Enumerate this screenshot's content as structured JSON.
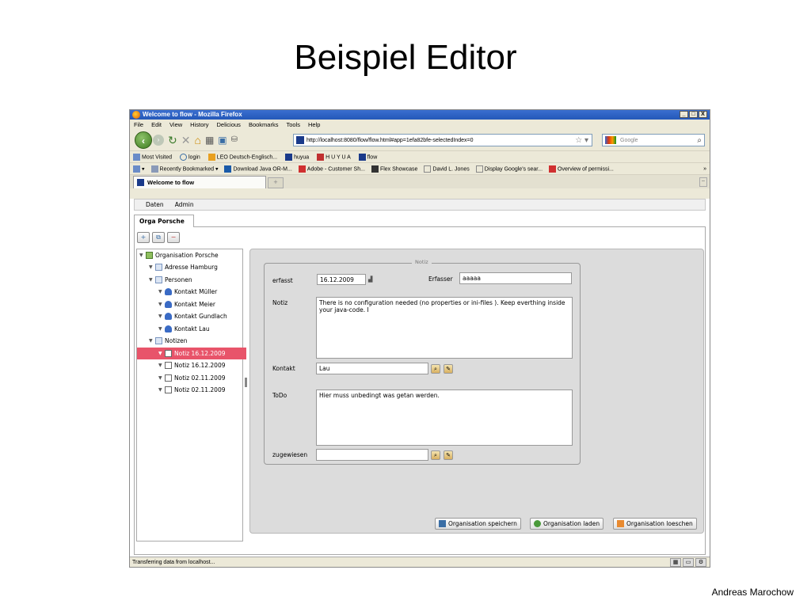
{
  "slide": {
    "title": "Beispiel Editor",
    "footer": "Andreas Marochow"
  },
  "browser": {
    "window_title": "Welcome to flow - Mozilla Firefox",
    "window_buttons": [
      "_",
      "□",
      "X"
    ],
    "menu": [
      "File",
      "Edit",
      "View",
      "History",
      "Delicious",
      "Bookmarks",
      "Tools",
      "Help"
    ],
    "url": "http://localhost:8080/flow/flow.html#app=1efa82bfe-selectedIndex=0",
    "search_placeholder": "Google",
    "bookmarks_row1": [
      "Most Visited",
      "login",
      "LEO Deutsch-Englisch...",
      "huyua",
      "H U Y U A",
      "flow"
    ],
    "bookmarks_row2": [
      "Recently Bookmarked",
      "Download Java OR-M...",
      "Adobe - Customer Sh...",
      "Flex Showcase",
      "David L. Jones",
      "Display Google's sear...",
      "Overview of permissi..."
    ],
    "overflow": "»",
    "tab_title": "Welcome to flow",
    "new_tab": "+",
    "status_text": "Transferring data from localhost..."
  },
  "app": {
    "menu": [
      "Daten",
      "Admin"
    ],
    "tab": "Orga Porsche",
    "tree": [
      {
        "label": "Organisation Porsche",
        "icon": "org-icon",
        "level": 0,
        "selected": false
      },
      {
        "label": "Adresse Hamburg",
        "icon": "folder-icon",
        "level": 1,
        "selected": false
      },
      {
        "label": "Personen",
        "icon": "folder-icon",
        "level": 1,
        "selected": false
      },
      {
        "label": "Kontakt Müller",
        "icon": "user-icon",
        "level": 2,
        "selected": false
      },
      {
        "label": "Kontakt Meier",
        "icon": "user-icon",
        "level": 2,
        "selected": false
      },
      {
        "label": "Kontakt Gundlach",
        "icon": "user-icon",
        "level": 2,
        "selected": false
      },
      {
        "label": "Kontakt Lau",
        "icon": "user-icon",
        "level": 2,
        "selected": false
      },
      {
        "label": "Notizen",
        "icon": "folder-icon",
        "level": 1,
        "selected": false
      },
      {
        "label": "Notiz 16.12.2009",
        "icon": "note-icon",
        "level": 2,
        "selected": true
      },
      {
        "label": "Notiz 16.12.2009",
        "icon": "note-icon",
        "level": 2,
        "selected": false
      },
      {
        "label": "Notiz 02.11.2009",
        "icon": "note-icon",
        "level": 2,
        "selected": false
      },
      {
        "label": "Notiz 02.11.2009",
        "icon": "note-icon",
        "level": 2,
        "selected": false
      }
    ],
    "form": {
      "legend": "Notiz",
      "erfasst_label": "erfasst",
      "erfasst_value": "16.12.2009",
      "erfasser_label": "Erfasser",
      "erfasser_value": "aaaaa",
      "notiz_label": "Notiz",
      "notiz_value": "There is no configuration needed (no properties or ini-files ). Keep everthing inside your java-code. I",
      "kontakt_label": "Kontakt",
      "kontakt_value": "Lau",
      "todo_label": "ToDo",
      "todo_value": "Hier muss unbedingt was getan werden.",
      "zugewiesen_label": "zugewiesen",
      "zugewiesen_value": ""
    },
    "buttons": {
      "save": "Organisation speichern",
      "load": "Organisation laden",
      "delete": "Organisation loeschen"
    }
  }
}
